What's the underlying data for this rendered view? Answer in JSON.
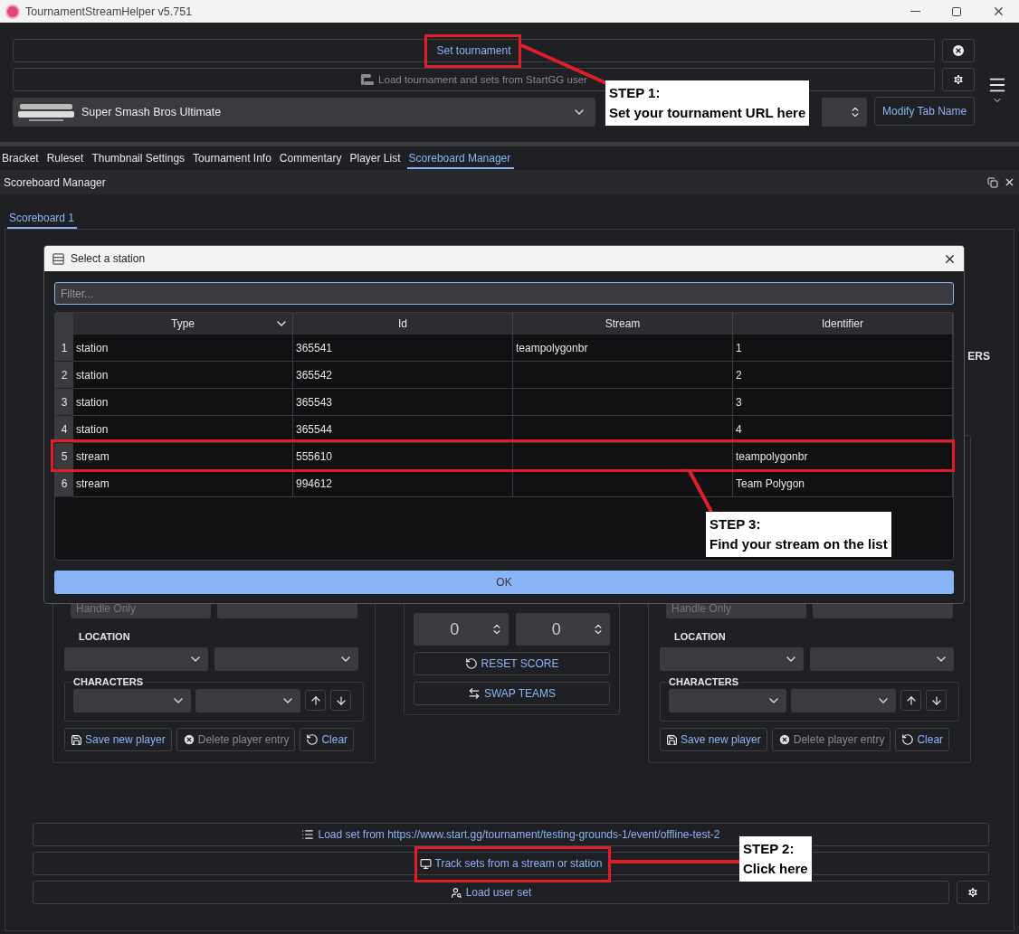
{
  "window": {
    "title": "TournamentStreamHelper v5.751"
  },
  "header": {
    "set_tournament": "Set tournament",
    "load_startgg": {
      "label": "Load tournament and sets from StartGG user",
      "disabled": true
    },
    "game": "Super Smash Bros Ultimate",
    "modify_tab": "Modify Tab Name"
  },
  "tabs": [
    {
      "label": "Bracket",
      "selected": false
    },
    {
      "label": "Ruleset",
      "selected": false
    },
    {
      "label": "Thumbnail Settings",
      "selected": false
    },
    {
      "label": "Tournament Info",
      "selected": false
    },
    {
      "label": "Commentary",
      "selected": false
    },
    {
      "label": "Player List",
      "selected": false
    },
    {
      "label": "Scoreboard Manager",
      "selected": true
    }
  ],
  "dock": {
    "title": "Scoreboard Manager",
    "tabs": [
      {
        "label": "Scoreboard 1",
        "selected": true
      }
    ]
  },
  "scoreboard": {
    "team_title_fragment": "ERS",
    "teams": [
      {
        "handle_placeholder": "Handle Only",
        "location_label": "LOCATION",
        "characters_label": "CHARACTERS",
        "buttons": [
          {
            "label": "Save new player",
            "kind": "save",
            "disabled": false
          },
          {
            "label": "Delete player entry",
            "kind": "delete",
            "disabled": true
          },
          {
            "label": "Clear",
            "kind": "undo",
            "disabled": false
          }
        ]
      },
      {
        "handle_placeholder": "Handle Only",
        "location_label": "LOCATION",
        "characters_label": "CHARACTERS",
        "buttons": [
          {
            "label": "Save new player",
            "kind": "save",
            "disabled": false
          },
          {
            "label": "Delete player entry",
            "kind": "delete",
            "disabled": true
          },
          {
            "label": "Clear",
            "kind": "undo",
            "disabled": false
          }
        ]
      }
    ],
    "scores": [
      "0",
      "0"
    ],
    "reset": "RESET SCORE",
    "swap": "SWAP TEAMS"
  },
  "bottom_buttons": [
    {
      "label": "Load set from https://www.start.gg/tournament/testing-grounds-1/event/offline-test-2",
      "kind": "list"
    },
    {
      "label": "Track sets from a stream or station",
      "kind": "monitor"
    },
    {
      "label": "Load user set",
      "kind": "user-search"
    }
  ],
  "dialog": {
    "title": "Select a station",
    "filter_placeholder": "Filter...",
    "columns": [
      "Type",
      "Id",
      "Stream",
      "Identifier"
    ],
    "rows": [
      {
        "num": "1",
        "cells": [
          "station",
          "365541",
          "teampolygonbr",
          "1"
        ]
      },
      {
        "num": "2",
        "cells": [
          "station",
          "365542",
          "",
          "2"
        ]
      },
      {
        "num": "3",
        "cells": [
          "station",
          "365543",
          "",
          "3"
        ]
      },
      {
        "num": "4",
        "cells": [
          "station",
          "365544",
          "",
          "4"
        ]
      },
      {
        "num": "5",
        "cells": [
          "stream",
          "555610",
          "",
          "teampolygonbr"
        ]
      },
      {
        "num": "6",
        "cells": [
          "stream",
          "994612",
          "",
          "Team Polygon"
        ]
      }
    ],
    "ok": "OK"
  },
  "annotations": [
    {
      "lines": [
        "STEP 1:",
        "Set your tournament URL here"
      ]
    },
    {
      "lines": [
        "STEP 3:",
        "Find your stream on the list"
      ]
    },
    {
      "lines": [
        "STEP 2:",
        "Click here"
      ]
    }
  ]
}
